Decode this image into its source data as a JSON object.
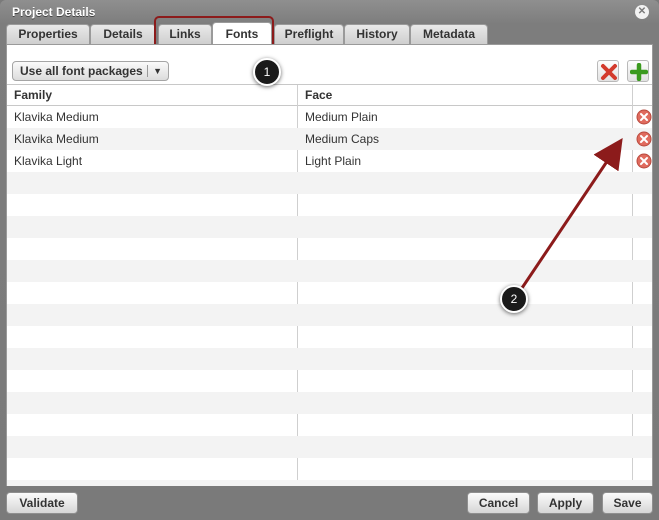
{
  "window": {
    "title": "Project Details"
  },
  "tabs": [
    {
      "label": "Properties"
    },
    {
      "label": "Details"
    },
    {
      "label": "Links"
    },
    {
      "label": "Fonts",
      "active": true
    },
    {
      "label": "Preflight"
    },
    {
      "label": "History"
    },
    {
      "label": "Metadata"
    }
  ],
  "toolbar": {
    "select_label": "Use all font packages"
  },
  "table": {
    "columns": [
      "Family",
      "Face"
    ],
    "rows": [
      {
        "family": "Klavika Medium",
        "face": "Medium Plain"
      },
      {
        "family": "Klavika Medium",
        "face": "Medium Caps"
      },
      {
        "family": "Klavika Light",
        "face": "Light Plain"
      }
    ]
  },
  "footer": {
    "validate_label": "Validate",
    "cancel_label": "Cancel",
    "apply_label": "Apply",
    "save_label": "Save"
  },
  "callouts": [
    "1",
    "2"
  ],
  "colors": {
    "highlight": "#8c1b1b",
    "delete": "#d9534f",
    "add": "#3a9a1e",
    "remove": "#d33a2c"
  },
  "icons": [
    "close-icon",
    "chevron-down-icon",
    "remove-all-icon",
    "add-icon",
    "delete-row-icon"
  ]
}
